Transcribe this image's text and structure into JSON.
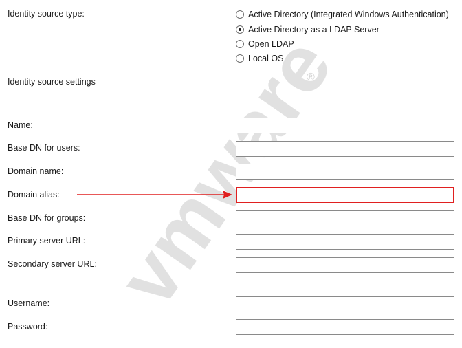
{
  "identity_source_type": {
    "label": "Identity source type:",
    "options": [
      {
        "label": "Active Directory (Integrated Windows Authentication)",
        "checked": false
      },
      {
        "label": "Active Directory as a LDAP Server",
        "checked": true
      },
      {
        "label": "Open LDAP",
        "checked": false
      },
      {
        "label": "Local OS",
        "checked": false
      }
    ]
  },
  "settings_heading": "Identity source settings",
  "fields": {
    "name": {
      "label": "Name:",
      "value": ""
    },
    "base_dn_users": {
      "label": "Base DN for users:",
      "value": ""
    },
    "domain_name": {
      "label": "Domain name:",
      "value": ""
    },
    "domain_alias": {
      "label": "Domain alias:",
      "value": ""
    },
    "base_dn_groups": {
      "label": "Base DN for groups:",
      "value": ""
    },
    "primary_server_url": {
      "label": "Primary server URL:",
      "value": ""
    },
    "secondary_server_url": {
      "label": "Secondary server URL:",
      "value": ""
    },
    "username": {
      "label": "Username:",
      "value": ""
    },
    "password": {
      "label": "Password:",
      "value": ""
    }
  },
  "watermark": {
    "text": "vmware",
    "registered": "®"
  },
  "annotation": {
    "arrow_color": "#e02020"
  }
}
